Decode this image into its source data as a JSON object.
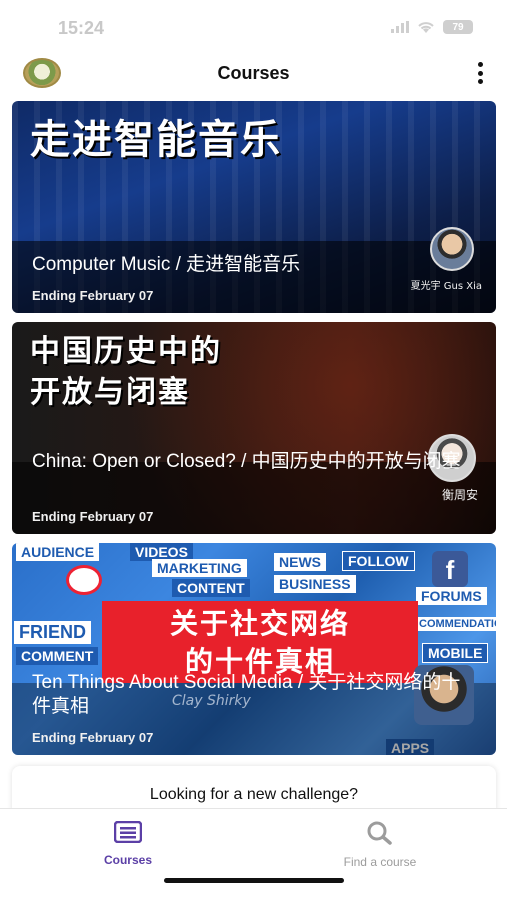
{
  "status_bar": {
    "time": "15:24",
    "battery": "79"
  },
  "header": {
    "title": "Courses"
  },
  "courses": [
    {
      "hero_text": [
        "走进智能音乐"
      ],
      "title": "Computer Music / 走进智能音乐",
      "ending": "Ending February 07",
      "instructor": "夏光宇 Gus Xia"
    },
    {
      "hero_text": [
        "中国历史中的",
        "开放与闭塞"
      ],
      "title": "China: Open or Closed? / 中国历史中的开放与闭塞",
      "ending": "Ending February 07",
      "instructor": "衡周安"
    },
    {
      "hero_text": [
        "关于社交网络",
        "的十件真相"
      ],
      "title": "Ten Things About Social Media / 关于社交网络的十件真相",
      "ending": "Ending February 07",
      "instructor": "Clay Shirky",
      "background_words": [
        "AUDIENCE",
        "VIDEOS",
        "NEWS",
        "FOLLOW",
        "MARKETING",
        "CONTENT",
        "BUSINESS",
        "FRIEND",
        "COMMENT",
        "MOBILE",
        "APPS",
        "FORUMS",
        "COMMENDATION"
      ]
    }
  ],
  "challenge": {
    "text": "Looking for a new challenge?"
  },
  "tabs": [
    {
      "label": "Courses",
      "icon": "courses-icon",
      "active": true
    },
    {
      "label": "Find a course",
      "icon": "search-icon",
      "active": false
    }
  ],
  "colors": {
    "accent": "#5b3fa6",
    "inactive": "#9c9c9c",
    "banner_red": "#e8212b"
  }
}
